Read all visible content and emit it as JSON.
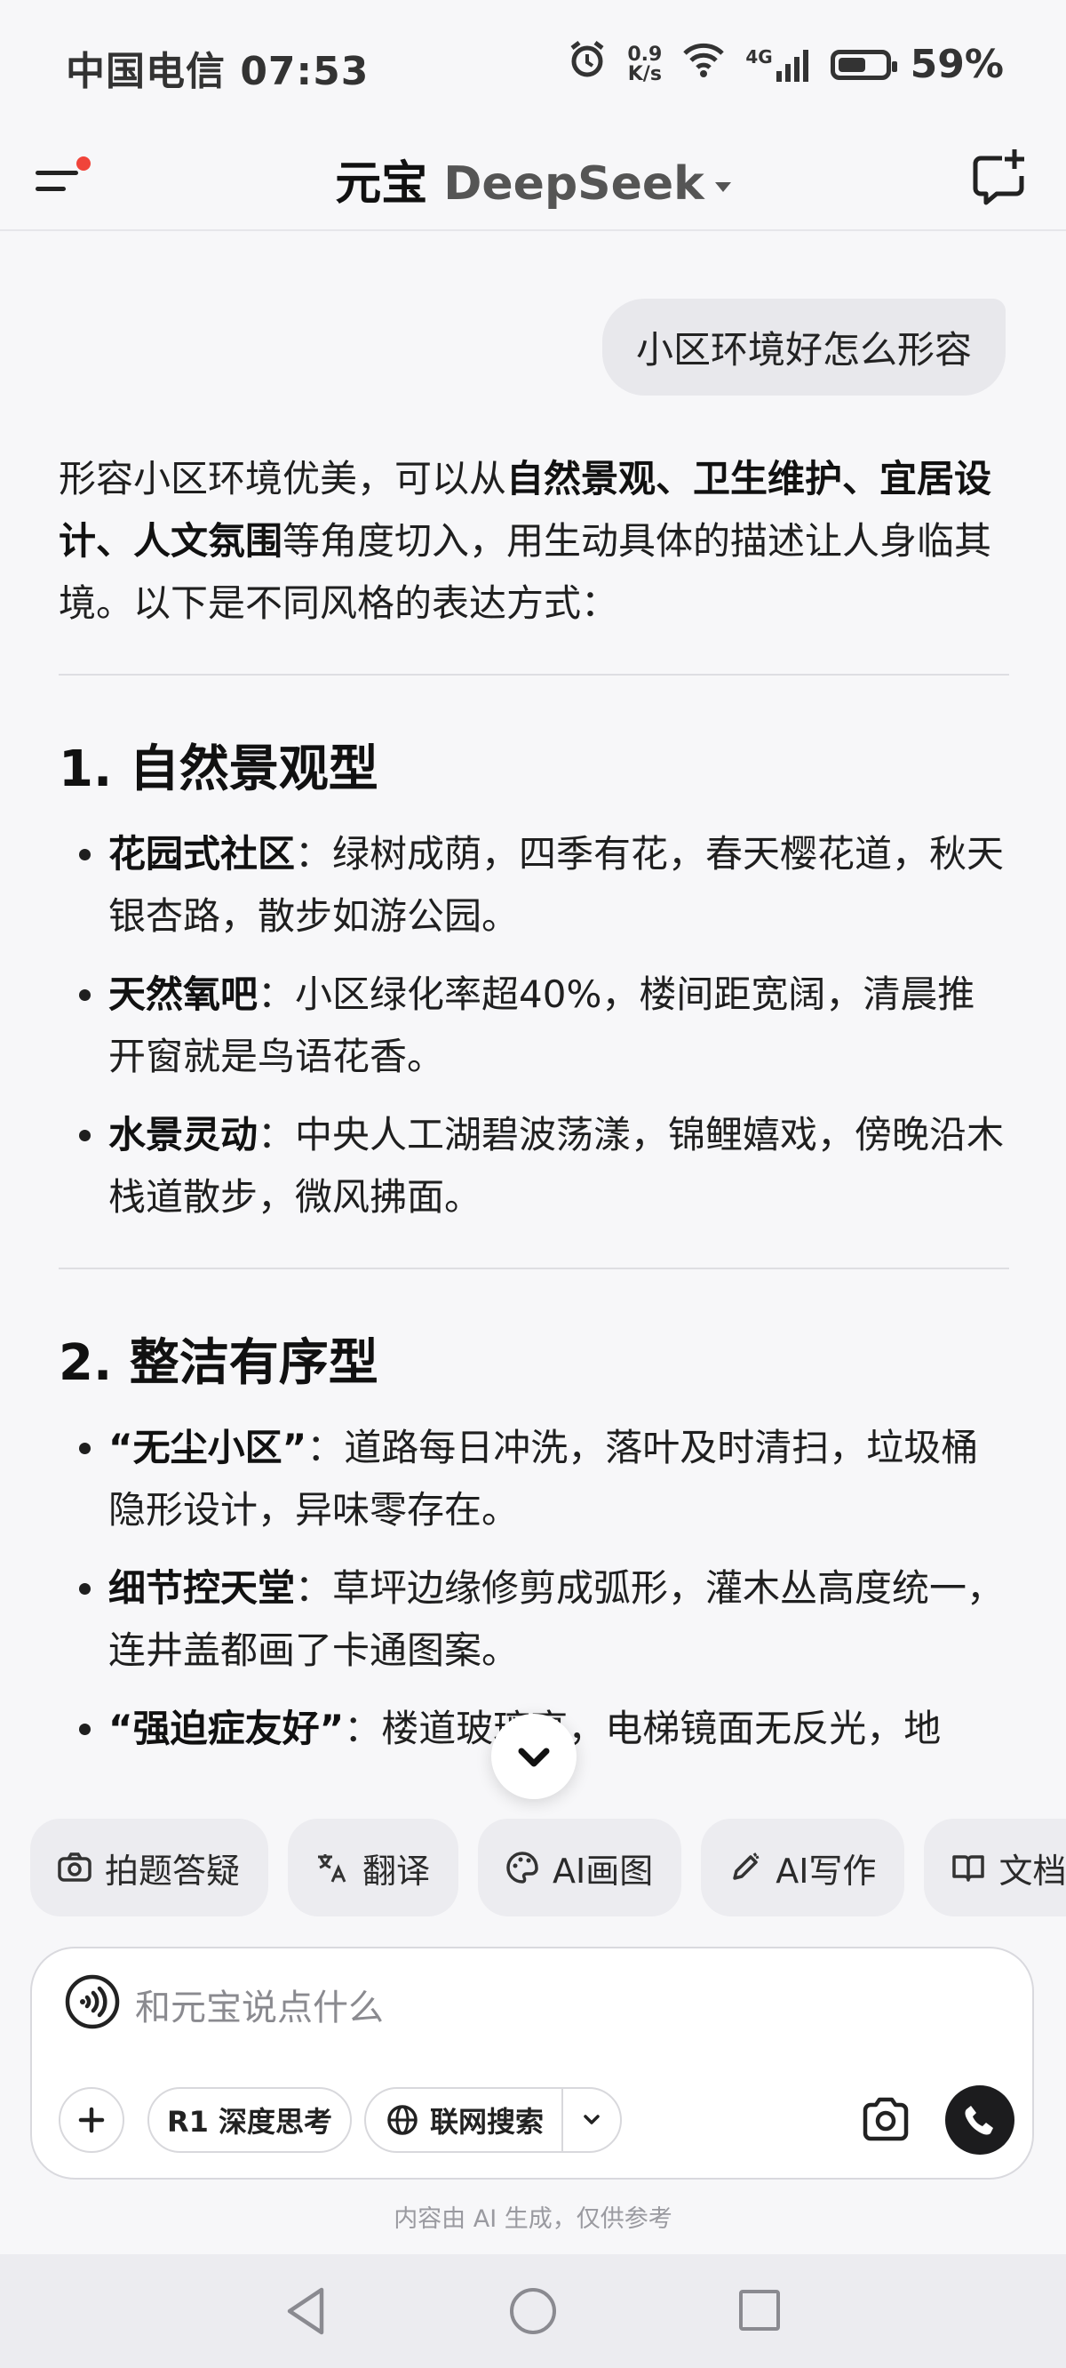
{
  "status_bar": {
    "carrier_time": "中国电信 07:53",
    "net_speed_value": "0.9",
    "net_speed_unit": "K/s",
    "network": "4G",
    "battery_percent": "59%",
    "battery_level": 0.59
  },
  "header": {
    "title": "元宝",
    "model": "DeepSeek"
  },
  "chat": {
    "user_message": "小区环境好怎么形容",
    "intro": {
      "t1": "形容小区环境优美，可以从",
      "b1": "自然景观、卫生维护、宜居设计、人文氛围",
      "t2": "等角度切入，用生动具体的描述让人身临其境。以下是不同风格的表达方式："
    },
    "sections": [
      {
        "title": "1. 自然景观型",
        "items": [
          {
            "term": "花园式社区",
            "text": "：绿树成荫，四季有花，春天樱花道，秋天银杏路，散步如游公园。"
          },
          {
            "term": "天然氧吧",
            "text": "：小区绿化率超40%，楼间距宽阔，清晨推开窗就是鸟语花香。"
          },
          {
            "term": "水景灵动",
            "text": "：中央人工湖碧波荡漾，锦鲤嬉戏，傍晚沿木栈道散步，微风拂面。"
          }
        ]
      },
      {
        "title": "2. 整洁有序型",
        "items": [
          {
            "term": "“无尘小区”",
            "text": "：道路每日冲洗，落叶及时清扫，垃圾桶隐形设计，异味零存在。"
          },
          {
            "term": "细节控天堂",
            "text": "：草坪边缘修剪成弧形，灌木丛高度统一，连井盖都画了卡通图案。"
          },
          {
            "term": "“强迫症友好”",
            "text": "：楼道玻璃亮，电梯镜面无反光，地"
          }
        ]
      }
    ]
  },
  "tools": [
    "拍题答疑",
    "翻译",
    "AI画图",
    "AI写作",
    "文档"
  ],
  "input": {
    "placeholder": "和元宝说点什么",
    "r1_label": "R1 深度思考",
    "search_label": "联网搜索"
  },
  "disclaimer": "内容由 AI 生成，仅供参考"
}
